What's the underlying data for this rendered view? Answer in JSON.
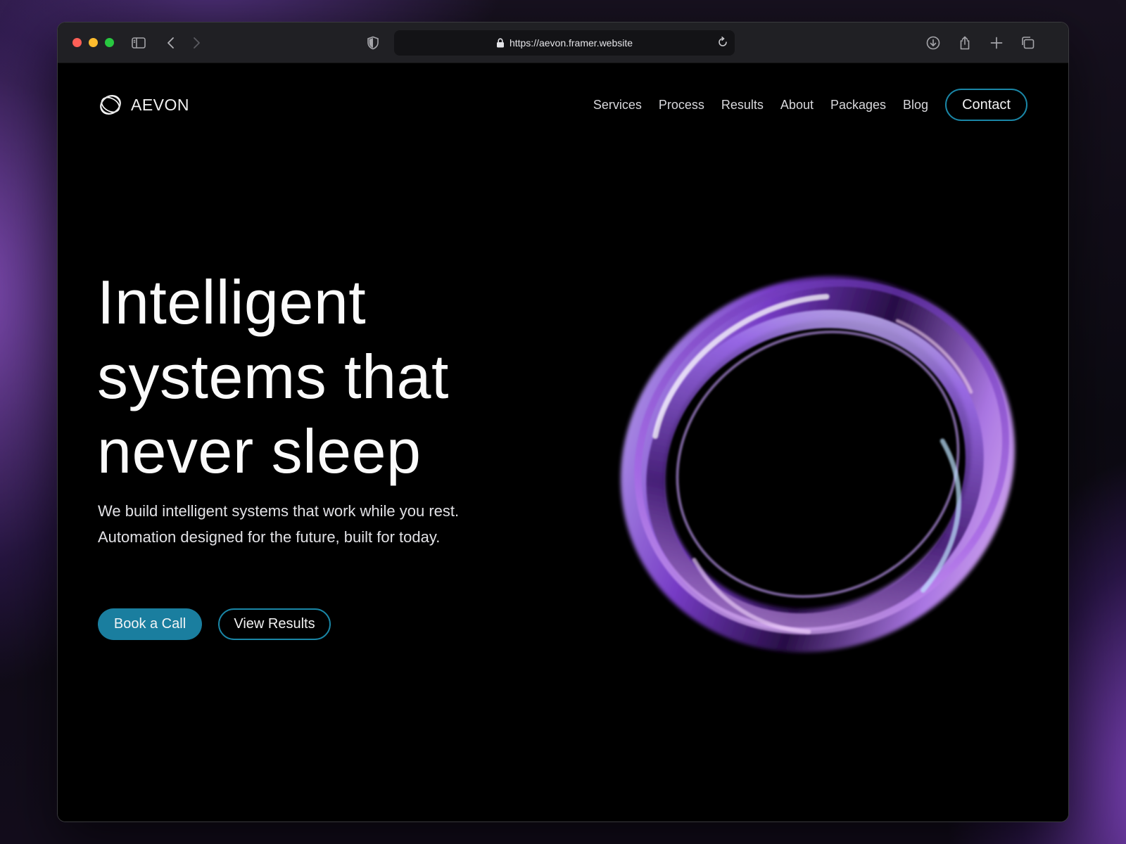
{
  "browser": {
    "url": "https://aevon.framer.website",
    "icons": [
      "sidebar-icon",
      "back-icon",
      "forward-icon",
      "shield-icon",
      "lock-icon",
      "reload-icon",
      "download-icon",
      "share-icon",
      "new-tab-icon",
      "tab-overview-icon"
    ]
  },
  "site": {
    "logo_text": "AEVON",
    "nav": {
      "items": [
        "Services",
        "Process",
        "Results",
        "About",
        "Packages",
        "Blog"
      ],
      "contact": "Contact"
    },
    "hero": {
      "title_lines": [
        "Intelligent",
        "systems that",
        "never sleep"
      ],
      "subtitle_lines": [
        "We build intelligent systems that work while you rest.",
        "Automation designed for the future, built for today."
      ],
      "primary_cta": "Book a Call",
      "secondary_cta": "View Results"
    }
  },
  "colors": {
    "accent": "#1a7e9f",
    "accent_outline": "#1a86a6",
    "background": "#000000",
    "ring_purple": "#a764e6"
  }
}
